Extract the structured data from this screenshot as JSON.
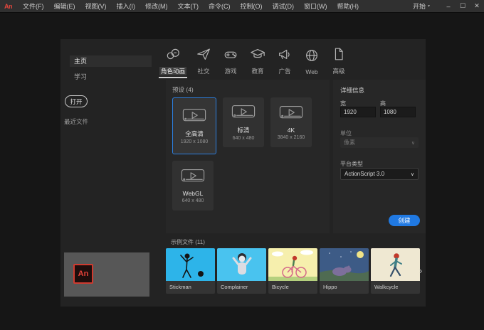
{
  "titlebar": {
    "app_icon_label": "An",
    "menus": [
      "文件(F)",
      "编辑(E)",
      "视图(V)",
      "插入(I)",
      "修改(M)",
      "文本(T)",
      "命令(C)",
      "控制(O)",
      "调试(D)",
      "窗口(W)",
      "帮助(H)"
    ],
    "workspace": "开始",
    "workspace_caret": "▾",
    "window_controls": {
      "minimize": "–",
      "maximize": "☐",
      "close": "✕"
    }
  },
  "sidebar": {
    "items": [
      {
        "label": "主页",
        "active": true
      },
      {
        "label": "学习",
        "active": false
      }
    ],
    "open_button": "打开",
    "recent_label": "最近文件"
  },
  "tabs": [
    {
      "label": "角色动画",
      "icon": "character-animation-icon",
      "active": true
    },
    {
      "label": "社交",
      "icon": "paper-plane-icon",
      "active": false
    },
    {
      "label": "游戏",
      "icon": "game-controller-icon",
      "active": false
    },
    {
      "label": "教育",
      "icon": "graduation-cap-icon",
      "active": false
    },
    {
      "label": "广告",
      "icon": "megaphone-icon",
      "active": false
    },
    {
      "label": "Web",
      "icon": "globe-icon",
      "active": false
    },
    {
      "label": "高级",
      "icon": "document-icon",
      "active": false
    }
  ],
  "presets": {
    "heading": "预设 (4)",
    "cards": [
      {
        "name": "全高清",
        "size": "1920 x 1080",
        "selected": true
      },
      {
        "name": "标清",
        "size": "640 x 480",
        "selected": false
      },
      {
        "name": "4K",
        "size": "3840 x 2160",
        "selected": false
      },
      {
        "name": "WebGL",
        "size": "640 x 480",
        "selected": false
      }
    ]
  },
  "details": {
    "heading": "详细信息",
    "width_label": "宽",
    "width_value": "1920",
    "height_label": "高",
    "height_value": "1080",
    "units_label": "单位",
    "units_value": "像素",
    "select_chevron": "∨",
    "platform_label": "平台类型",
    "platform_value": "ActionScript 3.0",
    "create_button": "创建"
  },
  "samples": {
    "heading": "示例文件 (11)",
    "items": [
      {
        "name": "Stickman"
      },
      {
        "name": "Complainer"
      },
      {
        "name": "Bicycle"
      },
      {
        "name": "Hippo"
      },
      {
        "name": "Walkcycle"
      }
    ],
    "next_glyph": "›"
  },
  "branding": {
    "logo_text": "An"
  },
  "colors": {
    "accent_blue": "#2079e2",
    "selection_border": "#2c7fe0",
    "logo_red": "#e2463c",
    "panel_bg": "#232323",
    "block_bg": "#272727",
    "titlebar_bg": "#303030"
  }
}
